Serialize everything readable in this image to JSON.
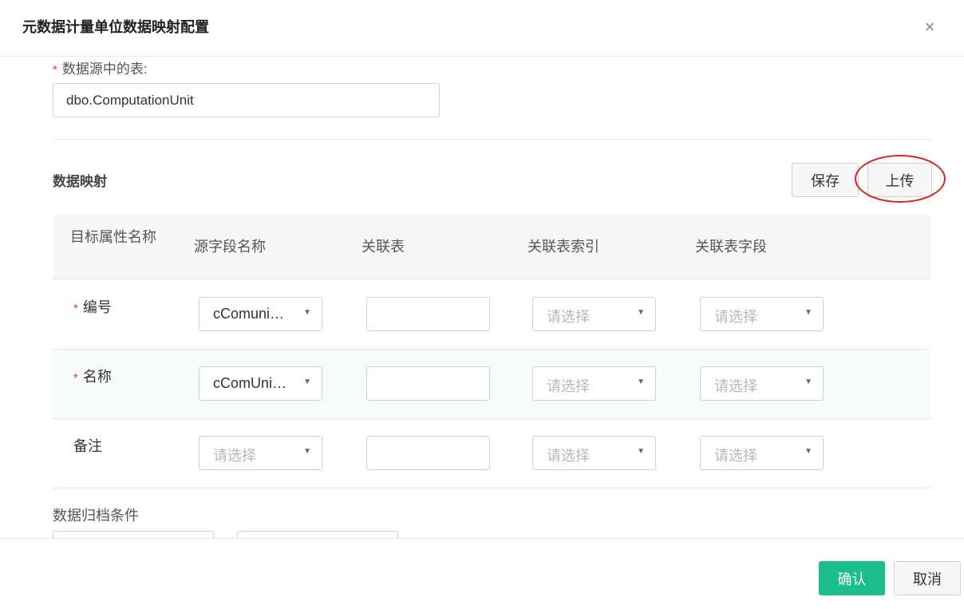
{
  "dialog": {
    "title": "元数据计量单位数据映射配置",
    "close_glyph": "×"
  },
  "source_table": {
    "required_mark": "*",
    "label": "数据源中的表:",
    "value": "dbo.ComputationUnit"
  },
  "mapping": {
    "title": "数据映射",
    "save_label": "保存",
    "upload_label": "上传",
    "columns": [
      "目标属性名称",
      "源字段名称",
      "关联表",
      "关联表索引",
      "关联表字段"
    ],
    "rows": [
      {
        "required_mark": "*",
        "target": "编号",
        "source_field": "cComuni…",
        "related_table": "",
        "related_index": "请选择",
        "related_field": "请选择"
      },
      {
        "required_mark": "*",
        "target": "名称",
        "source_field": "cComUni…",
        "related_table": "",
        "related_index": "请选择",
        "related_field": "请选择"
      },
      {
        "required_mark": "",
        "target": "备注",
        "source_field": "请选择",
        "related_table": "",
        "related_index": "请选择",
        "related_field": "请选择"
      }
    ]
  },
  "archive": {
    "label": "数据归档条件"
  },
  "footer": {
    "confirm_label": "确认",
    "cancel_label": "取消"
  },
  "colors": {
    "primary": "#19be8b",
    "required": "#e53935",
    "highlight": "#e02020"
  },
  "icons": {
    "close": "close-icon",
    "dropdown": "chevron-down-icon"
  }
}
